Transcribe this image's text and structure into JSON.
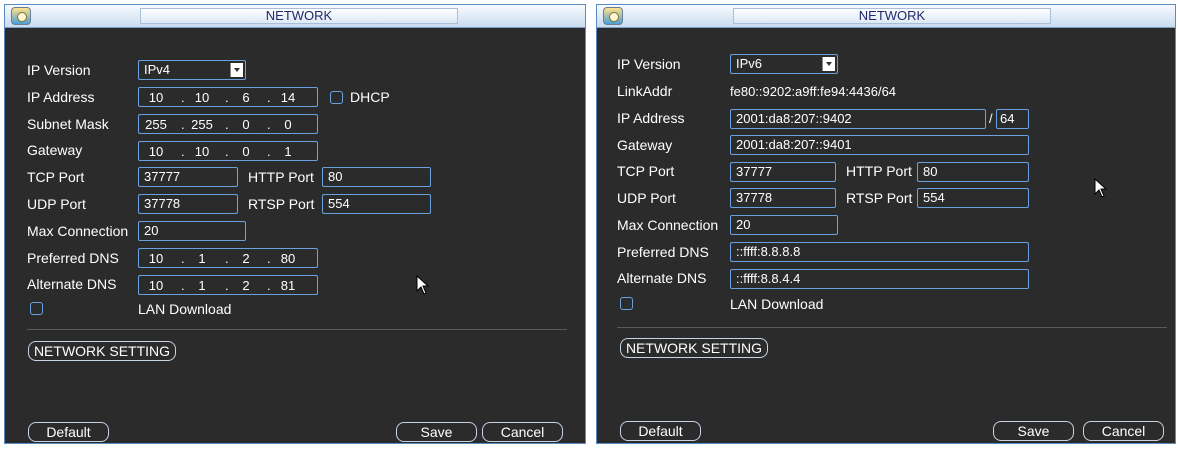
{
  "left": {
    "title": "NETWORK",
    "labels": {
      "ip_version": "IP Version",
      "ip_address": "IP Address",
      "subnet_mask": "Subnet Mask",
      "gateway": "Gateway",
      "tcp_port": "TCP Port",
      "http_port": "HTTP Port",
      "udp_port": "UDP Port",
      "rtsp_port": "RTSP Port",
      "max_connection": "Max Connection",
      "preferred_dns": "Preferred DNS",
      "alternate_dns": "Alternate DNS",
      "dhcp": "DHCP",
      "lan_download": "LAN Download"
    },
    "ip_version": "IPv4",
    "ip_address": [
      "10",
      "10",
      "6",
      "14"
    ],
    "subnet_mask": [
      "255",
      "255",
      "0",
      "0"
    ],
    "gateway": [
      "10",
      "10",
      "0",
      "1"
    ],
    "tcp_port": "37777",
    "http_port": "80",
    "udp_port": "37778",
    "rtsp_port": "554",
    "max_connection": "20",
    "preferred_dns": [
      "10",
      "1",
      "2",
      "80"
    ],
    "alternate_dns": [
      "10",
      "1",
      "2",
      "81"
    ],
    "network_setting": "NETWORK SETTING",
    "buttons": {
      "default": "Default",
      "save": "Save",
      "cancel": "Cancel"
    }
  },
  "right": {
    "title": "NETWORK",
    "labels": {
      "ip_version": "IP Version",
      "link_addr": "LinkAddr",
      "ip_address": "IP Address",
      "gateway": "Gateway",
      "tcp_port": "TCP Port",
      "http_port": "HTTP Port",
      "udp_port": "UDP Port",
      "rtsp_port": "RTSP Port",
      "max_connection": "Max Connection",
      "preferred_dns": "Preferred DNS",
      "alternate_dns": "Alternate DNS",
      "lan_download": "LAN Download"
    },
    "ip_version": "IPv6",
    "link_addr": "fe80::9202:a9ff:fe94:4436/64",
    "ip_address": "2001:da8:207::9402",
    "prefix_separator": "/",
    "prefix_length": "64",
    "gateway": "2001:da8:207::9401",
    "tcp_port": "37777",
    "http_port": "80",
    "udp_port": "37778",
    "rtsp_port": "554",
    "max_connection": "20",
    "preferred_dns": "::ffff:8.8.8.8",
    "alternate_dns": "::ffff:8.8.4.4",
    "network_setting": "NETWORK SETTING",
    "buttons": {
      "default": "Default",
      "save": "Save",
      "cancel": "Cancel"
    }
  },
  "colors": {
    "panel_bg": "#2b2b2b",
    "field_border": "#6aa2e0",
    "title_text": "#1f2a6a"
  }
}
